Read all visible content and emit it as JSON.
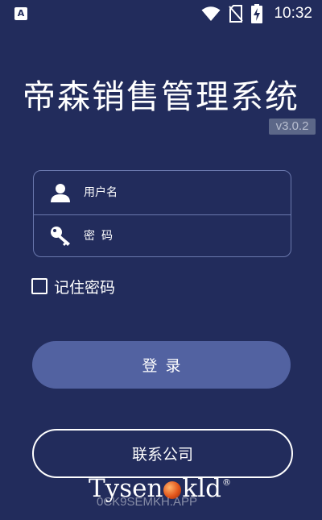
{
  "status_bar": {
    "left_icon_glyph": "A",
    "left_icon": "text-notification-icon",
    "right_icons": [
      "wifi-icon",
      "no-sim-icon",
      "battery-charging-icon"
    ],
    "time": "10:32"
  },
  "app": {
    "title": "帝森销售管理系统",
    "version": "v3.0.2"
  },
  "login_form": {
    "username": {
      "icon": "user-icon",
      "placeholder": "用户名",
      "value": ""
    },
    "password": {
      "icon": "key-icon",
      "placeholder": "密码",
      "value": ""
    },
    "remember": {
      "label": "记住密码",
      "checked": false
    },
    "login_label": "登录"
  },
  "contact_label": "联系公司",
  "brand": {
    "before": "Tysen",
    "after": "kld",
    "registered": "®"
  },
  "watermark": "0CK9SEMKH.APP",
  "colors": {
    "background": "#222c5c",
    "field_border": "#6a78ad",
    "login_button": "#5262a1",
    "version_badge": "#5c6788"
  }
}
